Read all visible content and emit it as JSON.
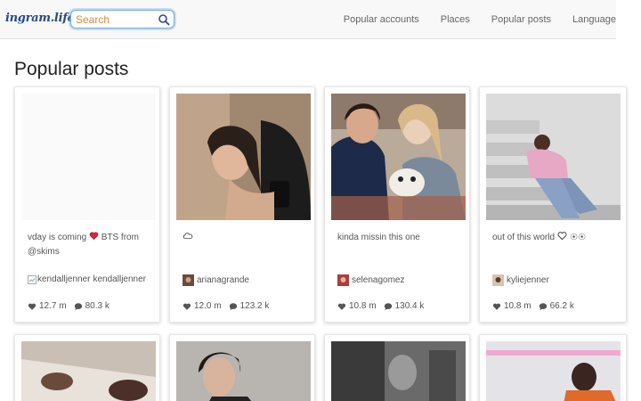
{
  "header": {
    "brand": "ingram.life",
    "search_placeholder": "Search",
    "nav": [
      "Popular accounts",
      "Places",
      "Popular posts",
      "Language"
    ]
  },
  "page_title": "Popular posts",
  "posts": [
    {
      "caption": "vday is coming",
      "caption_after": "BTS from @skims",
      "author_alt": "kendalljenner",
      "author": "kendalljenner",
      "likes": "12.7 m",
      "comments": "80.3 k"
    },
    {
      "caption": "",
      "author": "arianagrande",
      "likes": "12.0 m",
      "comments": "123.2 k"
    },
    {
      "caption": "kinda missin this one",
      "author": "selenagomez",
      "likes": "10.8 m",
      "comments": "130.4 k"
    },
    {
      "caption": "out of this world",
      "author": "kyliejenner",
      "likes": "10.8 m",
      "comments": "66.2 k"
    }
  ],
  "colors": {
    "brand": "#2a4a8a",
    "search_border": "#6fa8e8",
    "placeholder": "#e08a3c",
    "heart": "#d6283c"
  }
}
